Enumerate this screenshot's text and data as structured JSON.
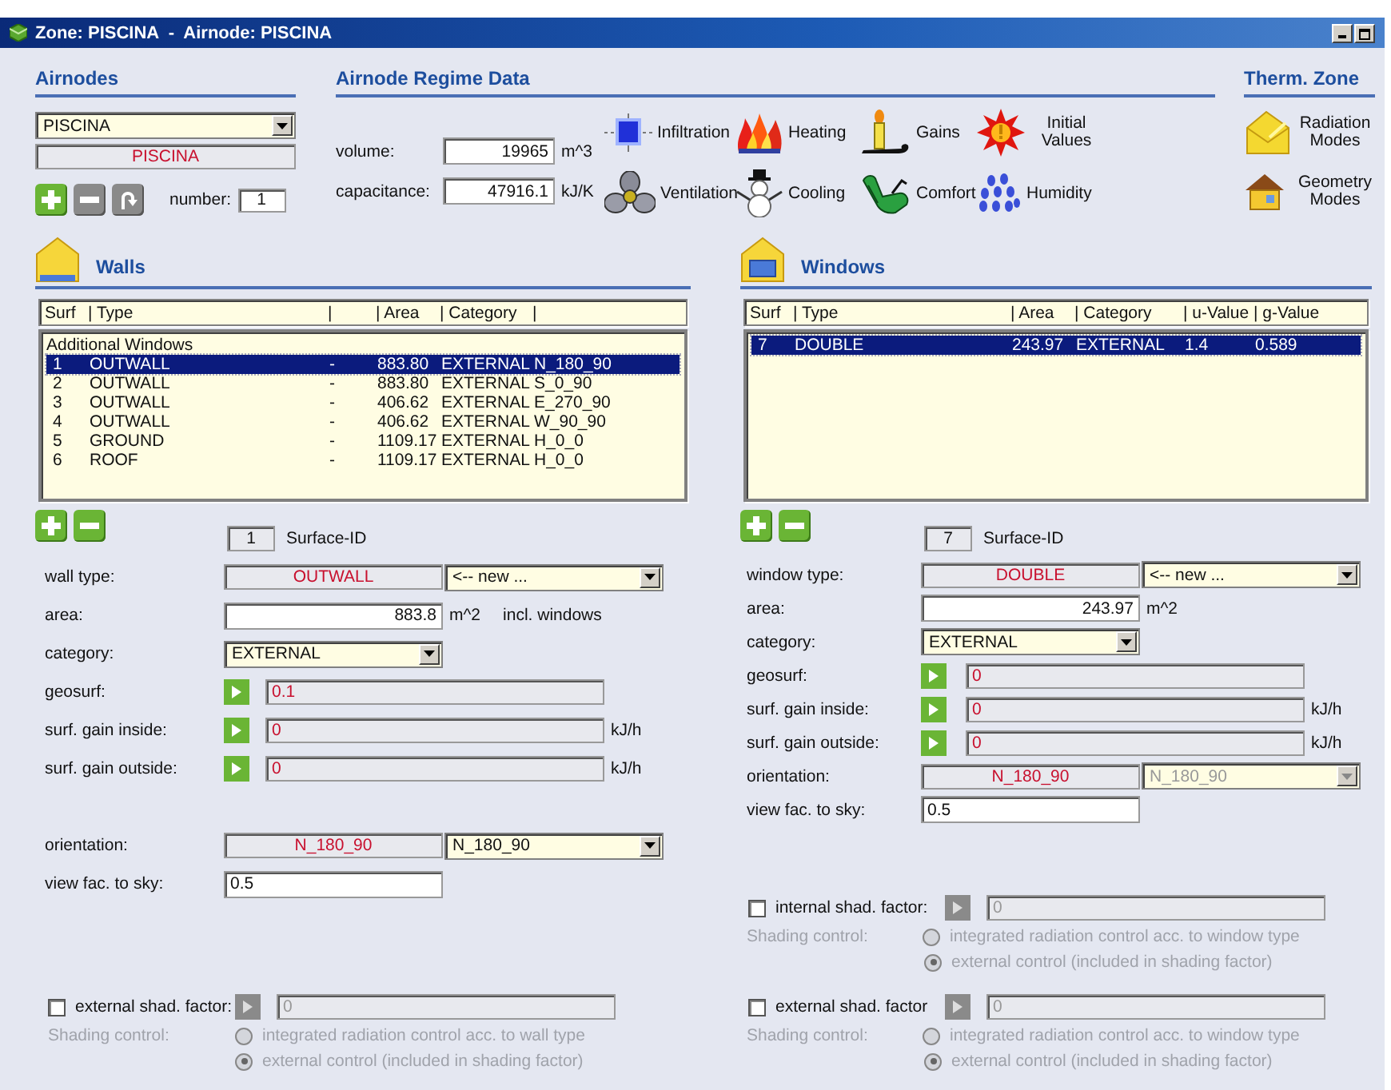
{
  "window": {
    "title": "Zone: PISCINA  -  Airnode: PISCINA"
  },
  "airnodes": {
    "heading": "Airnodes",
    "selector": "PISCINA",
    "name": "PISCINA",
    "number_label": "number:",
    "number": "1"
  },
  "regime": {
    "heading": "Airnode Regime Data",
    "fields": [
      {
        "label": "volume:",
        "value": "19965",
        "unit": "m^3"
      },
      {
        "label": "capacitance:",
        "value": "47916.1",
        "unit": "kJ/K"
      }
    ],
    "buttons": [
      {
        "kind": "infiltration",
        "label": "Infiltration"
      },
      {
        "kind": "heating",
        "label": "Heating"
      },
      {
        "kind": "gains",
        "label": "Gains"
      },
      {
        "kind": "initial",
        "label": "Initial Values"
      },
      {
        "kind": "ventilation",
        "label": "Ventilation"
      },
      {
        "kind": "cooling",
        "label": "Cooling"
      },
      {
        "kind": "comfort",
        "label": "Comfort"
      },
      {
        "kind": "humidity",
        "label": "Humidity"
      }
    ]
  },
  "therm_zone": {
    "heading": "Therm. Zone",
    "buttons": [
      {
        "kind": "radiation",
        "label": "Radiation Modes"
      },
      {
        "kind": "geometry",
        "label": "Geometry Modes"
      }
    ]
  },
  "walls": {
    "heading": "Walls",
    "table": {
      "columns": [
        "Surf",
        "| Type",
        "|",
        "| Area",
        "| Category",
        "|"
      ],
      "group": "Additional Windows",
      "rows": [
        {
          "cells": [
            "1",
            "OUTWALL",
            "-",
            "883.80",
            "EXTERNAL",
            "N_180_90"
          ],
          "selected": true
        },
        {
          "cells": [
            "2",
            "OUTWALL",
            "-",
            "883.80",
            "EXTERNAL",
            "S_0_90"
          ],
          "selected": false
        },
        {
          "cells": [
            "3",
            "OUTWALL",
            "-",
            "406.62",
            "EXTERNAL",
            "E_270_90"
          ],
          "selected": false
        },
        {
          "cells": [
            "4",
            "OUTWALL",
            "-",
            "406.62",
            "EXTERNAL",
            "W_90_90"
          ],
          "selected": false
        },
        {
          "cells": [
            "5",
            "GROUND",
            "-",
            "1109.17",
            "EXTERNAL",
            "H_0_0"
          ],
          "selected": false
        },
        {
          "cells": [
            "6",
            "ROOF",
            "-",
            "1109.17",
            "EXTERNAL",
            "H_0_0"
          ],
          "selected": false
        }
      ]
    },
    "surface_id": {
      "value": "1",
      "label": "Surface-ID"
    },
    "fields": [
      {
        "kind": "type",
        "label": "wall type:",
        "value": "OUTWALL",
        "choice": "<-- new ...",
        "disabled": false
      },
      {
        "kind": "number",
        "label": "area:",
        "value": "883.8",
        "unit": "m^2",
        "note": "incl. windows"
      },
      {
        "kind": "combo",
        "label": "category:",
        "value": "EXTERNAL"
      },
      {
        "kind": "linked",
        "label": "geosurf:",
        "value": "0.1"
      },
      {
        "kind": "linked",
        "label": "surf. gain inside:",
        "value": "0",
        "unit": "kJ/h"
      },
      {
        "kind": "linked",
        "label": "surf. gain outside:",
        "value": "0",
        "unit": "kJ/h"
      }
    ],
    "lower_fields": [
      {
        "kind": "type",
        "label": "orientation:",
        "value": "N_180_90",
        "choice": "N_180_90",
        "disabled": false
      },
      {
        "kind": "text",
        "label": "view fac. to sky:",
        "value": "0.5"
      }
    ],
    "shading": [
      {
        "label": "external shad. factor:",
        "checked": false,
        "value": "0",
        "control_label": "Shading control:",
        "options": [
          {
            "label": "integrated radiation control acc. to wall type",
            "selected": false
          },
          {
            "label": "external control (included in shading factor)",
            "selected": true
          }
        ]
      }
    ]
  },
  "windows": {
    "heading": "Windows",
    "table": {
      "columns": [
        "Surf",
        "| Type",
        "| Area",
        "| Category",
        "| u-Value",
        "| g-Value"
      ],
      "rows": [
        {
          "cells": [
            "7",
            "DOUBLE",
            "243.97",
            "EXTERNAL",
            "1.4",
            "0.589"
          ],
          "selected": true
        }
      ]
    },
    "surface_id": {
      "value": "7",
      "label": "Surface-ID"
    },
    "fields": [
      {
        "kind": "type",
        "label": "window type:",
        "value": "DOUBLE",
        "choice": "<-- new ...",
        "disabled": false
      },
      {
        "kind": "number",
        "label": "area:",
        "value": "243.97",
        "unit": "m^2"
      },
      {
        "kind": "combo",
        "label": "category:",
        "value": "EXTERNAL"
      },
      {
        "kind": "linked",
        "label": "geosurf:",
        "value": "0"
      },
      {
        "kind": "linked",
        "label": "surf. gain inside:",
        "value": "0",
        "unit": "kJ/h"
      },
      {
        "kind": "linked",
        "label": "surf. gain outside:",
        "value": "0",
        "unit": "kJ/h"
      },
      {
        "kind": "type",
        "label": "orientation:",
        "value": "N_180_90",
        "choice": "N_180_90",
        "disabled": true
      },
      {
        "kind": "text",
        "label": "view fac. to sky:",
        "value": "0.5"
      }
    ],
    "shading": [
      {
        "label": "internal shad. factor:",
        "checked": false,
        "value": "0",
        "control_label": "Shading control:",
        "options": [
          {
            "label": "integrated radiation control acc. to window type",
            "selected": false
          },
          {
            "label": "external control (included in shading factor)",
            "selected": true
          }
        ]
      },
      {
        "label": "external shad. factor",
        "checked": false,
        "value": "0",
        "control_label": "Shading control:",
        "options": [
          {
            "label": "integrated radiation control acc. to window type",
            "selected": false
          },
          {
            "label": "external control (included in shading factor)",
            "selected": true
          }
        ]
      }
    ]
  }
}
